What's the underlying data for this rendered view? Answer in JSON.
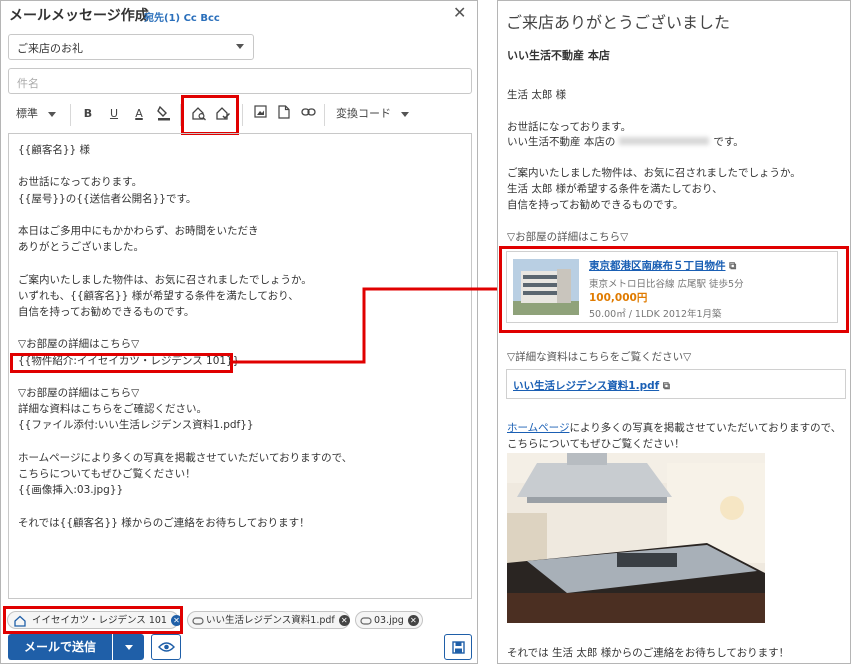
{
  "compose": {
    "title": "メールメッセージ作成",
    "recipients_links": "宛先(1) Cc Bcc",
    "template_select": "ご来店のお礼",
    "subject_placeholder": "件名",
    "toolbar": {
      "style_label": "標準",
      "bold": "B",
      "underline": "U",
      "font_color": "A",
      "convert_code": "変換コード"
    },
    "body_lines": [
      "{{顧客名}} 様",
      "",
      "お世話になっております。",
      "{{屋号}}の{{送信者公開名}}です。",
      "",
      "本日はご多用中にもかかわらず、お時間をいただき",
      "ありがとうございました。",
      "",
      "ご案内いたしました物件は、お気に召されましたでしょうか。",
      "いずれも、{{顧客名}} 様が希望する条件を満たしており、",
      "自信を持ってお勧めできるものです。",
      "",
      "▽お部屋の詳細はこちら▽",
      "{{物件紹介:イイセイカツ・レジデンス 101}}",
      "",
      "▽お部屋の詳細はこちら▽",
      "詳細な資料はこちらをご確認ください。",
      "{{ファイル添付:いい生活レジデンス資料1.pdf}}",
      "",
      "ホームページにより多くの写真を掲載させていただいておりますので、",
      "こちらについてもぜひご覧ください！",
      "{{画像挿入:03.jpg}}",
      "",
      "それでは{{顧客名}} 様からのご連絡をお待ちしております！"
    ],
    "attachments": [
      "イイセイカツ・レジデンス 101",
      "いい生活レジデンス資料1.pdf",
      "03.jpg"
    ],
    "send_label": "メールで送信"
  },
  "preview": {
    "heading": "ご来店ありがとうございました",
    "company": "いい生活不動産 本店",
    "greeting_name": "生活 太郎 様",
    "intro_1": "お世話になっております。",
    "intro_2_prefix": "いい生活不動産 本店の",
    "intro_2_suffix": "です。",
    "para_1": "ご案内いたしました物件は、お気に召されましたでしょうか。",
    "para_2": "生活 太郎 様が希望する条件を満たしており、",
    "para_3": "自信を持ってお勧めできるものです。",
    "room_header": "▽お部屋の詳細はこちら▽",
    "property": {
      "name": "東京都港区南麻布５丁目物件",
      "access": "東京メトロ日比谷線 広尾駅 徒歩5分",
      "price": "100,000円",
      "details": "50.00㎡ / 1LDK 2012年1月築"
    },
    "docs_header": "▽詳細な資料はこちらをご覧ください▽",
    "doc_link": "いい生活レジデンス資料1.pdf",
    "homepage_link": "ホームページ",
    "homepage_text": "により多くの写真を掲載させていただいておりますので、",
    "homepage_text_2": "こちらについてもぜひご覧ください！",
    "closing": "それでは 生活 太郎 様からのご連絡をお待ちしております！"
  },
  "colors": {
    "highlight": "#e00000",
    "brand_blue": "#1f5fa8",
    "price_orange": "#e07b00"
  }
}
